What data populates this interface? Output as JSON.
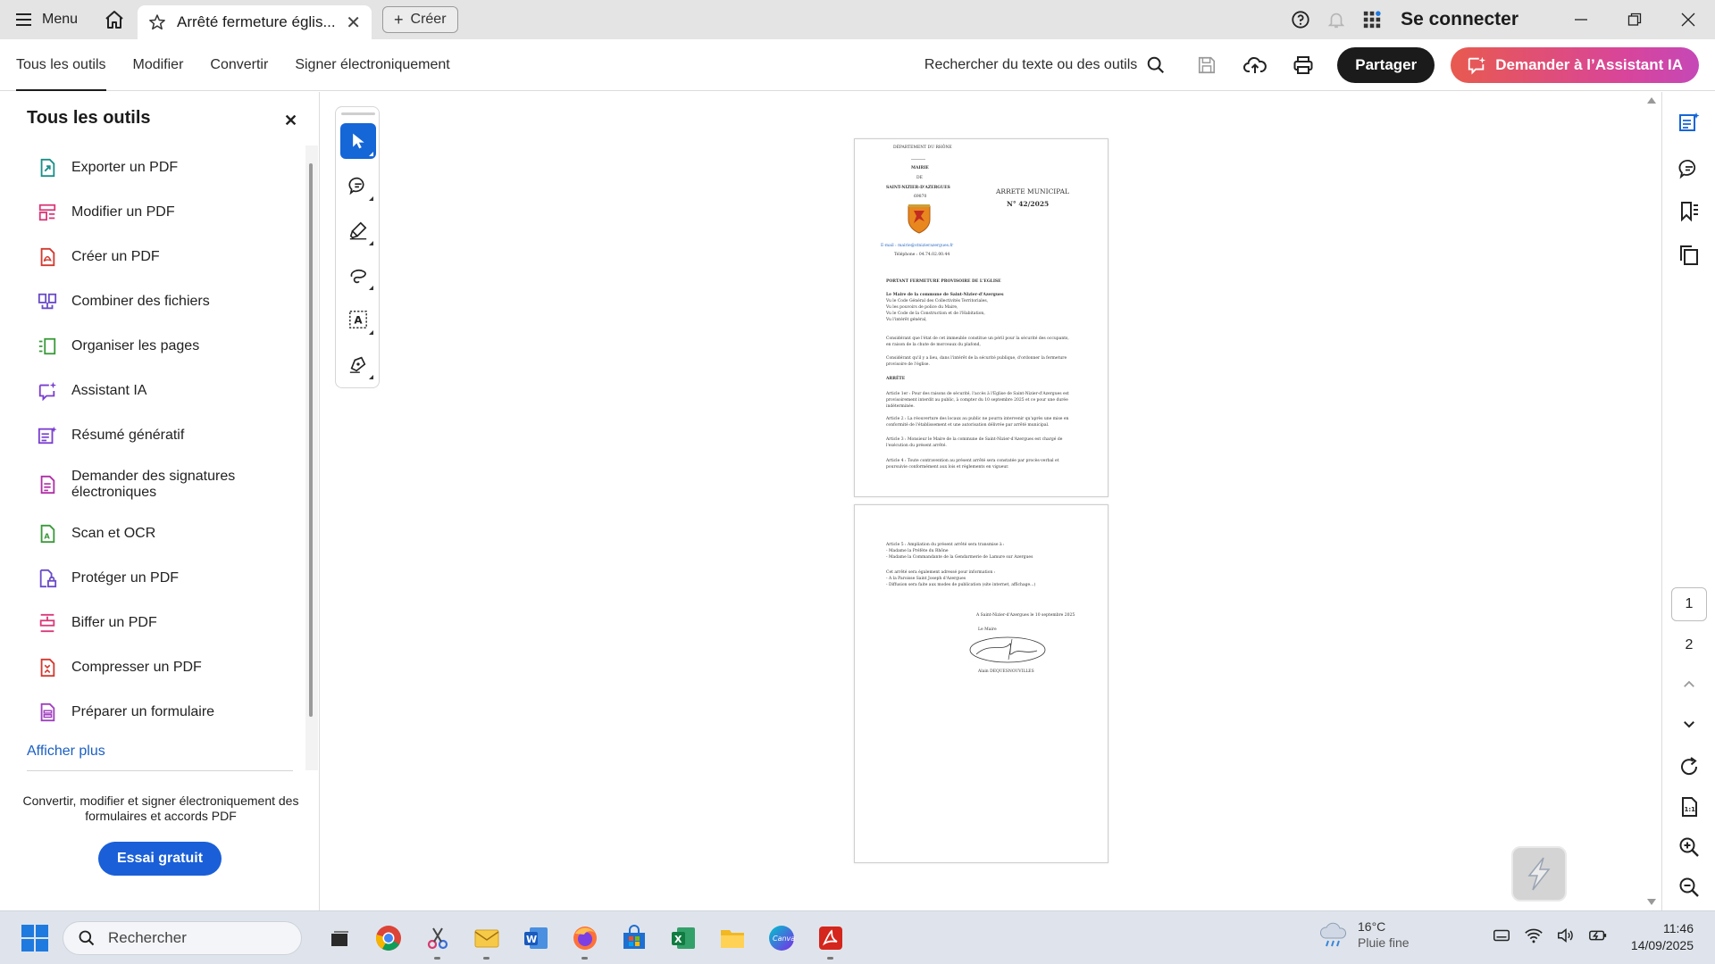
{
  "titlebar": {
    "menu_label": "Menu",
    "tab_title": "Arrêté fermeture églis...",
    "create_label": "Créer",
    "signin_label": "Se connecter"
  },
  "toolbar": {
    "tabs": [
      {
        "label": "Tous les outils"
      },
      {
        "label": "Modifier"
      },
      {
        "label": "Convertir"
      },
      {
        "label": "Signer électroniquement"
      }
    ],
    "search_label": "Rechercher du texte ou des outils",
    "share_label": "Partager",
    "ai_label": "Demander à l’Assistant IA"
  },
  "leftpanel": {
    "title": "Tous les outils",
    "tools": [
      {
        "label": "Exporter un PDF",
        "icon": "export-pdf-icon",
        "color": "#1a8f8a"
      },
      {
        "label": "Modifier un PDF",
        "icon": "edit-pdf-icon",
        "color": "#d93a7a"
      },
      {
        "label": "Créer un PDF",
        "icon": "create-pdf-icon",
        "color": "#d23a2f"
      },
      {
        "label": "Combiner des fichiers",
        "icon": "combine-files-icon",
        "color": "#6a4cc8"
      },
      {
        "label": "Organiser les pages",
        "icon": "organize-pages-icon",
        "color": "#3a9a3a"
      },
      {
        "label": "Assistant IA",
        "icon": "ai-assistant-icon",
        "color": "#7a3fd0"
      },
      {
        "label": "Résumé génératif",
        "icon": "generative-summary-icon",
        "color": "#7a3fd0"
      },
      {
        "label": "Demander des signatures électroniques",
        "icon": "request-signatures-icon",
        "color": "#b02fa6"
      },
      {
        "label": "Scan et OCR",
        "icon": "scan-ocr-icon",
        "color": "#3a9a3a"
      },
      {
        "label": "Protéger un PDF",
        "icon": "protect-pdf-icon",
        "color": "#6a4cc8"
      },
      {
        "label": "Biffer un PDF",
        "icon": "redact-pdf-icon",
        "color": "#d93a7a"
      },
      {
        "label": "Compresser un PDF",
        "icon": "compress-pdf-icon",
        "color": "#d23a2f"
      },
      {
        "label": "Préparer un formulaire",
        "icon": "prepare-form-icon",
        "color": "#a040c0"
      }
    ],
    "show_more": "Afficher plus",
    "promo_text": "Convertir, modifier et signer électroniquement des formulaires et accords PDF",
    "trial_label": "Essai gratuit"
  },
  "document": {
    "page1": {
      "dept": "DÉPARTEMENT DU RHÔNE",
      "mairie": "MAIRIE",
      "de": "DE",
      "commune": "SAINT-NIZIER-D'AZERGUES",
      "postcode": "69870",
      "email": "E-mail : mairie@stnizierazergues.fr",
      "phone": "Téléphone : 04.74.02.00.44",
      "arrete_title": "ARRETE MUNICIPAL",
      "arrete_num": "N° 42/2025",
      "objet": "PORTANT FERMETURE PROVISOIRE DE L'EGLISE",
      "lines": [
        "Le Maire de la commune de Saint-Nizier-d'Azergues",
        "Vu le Code Général des Collectivités Territoriales,",
        "Vu les pouvoirs de police du Maire,",
        "Vu le Code de la Construction et de l'Habitation,",
        "Vu l'intérêt général,"
      ],
      "considerant1": "Considérant que l'état de cet immeuble constitue un péril pour la sécurité des occupants,",
      "considerant1b": "en raison de la chute de morceaux du plafond,",
      "considerant2": "Considérant qu'il y a lieu, dans l'intérêt de la sécurité publique, d'ordonner la fermeture",
      "considerant2b": "provisoire de l'église.",
      "arrete": "ARRÊTE",
      "art1": "Article 1er : Pour des raisons de sécurité, l'accès à l'Eglise de Saint-Nizier-d'Azergues est",
      "art1b": "provisoirement interdit au public, à compter du 10 septembre 2025 et ce pour une durée",
      "art1c": "indéterminée.",
      "art2": "Article 2 : La réouverture des locaux au public ne pourra intervenir qu'après une mise en",
      "art2b": "conformité de l'établissement et une autorisation délivrée par arrêté municipal.",
      "art3": "Article 3 : Monsieur le Maire de la commune de Saint-Nizier-d'Azergues est chargé de",
      "art3b": "l'exécution du présent arrêté.",
      "art4": "Article 4 : Toute contravention au présent arrêté sera constatée par procès-verbal et",
      "art4b": "poursuivie conformément aux lois et règlements en vigueur."
    },
    "page2": {
      "art5": "Article 5 : Ampliation du présent arrêté sera transmise à :",
      "art5a": "- Madame la Préfète du Rhône",
      "art5b": "- Madame la Commandante de la Gendarmerie de Lamure sur Azergues",
      "info": "Cet arrêté sera également adressé pour information :",
      "info_a": "- A la Paroisse Saint Joseph d'Azergues",
      "info_b": "- Diffusion sera faite aux modes de publication (site internet, affichage...)",
      "place_date": "A Saint-Nizier-d'Azergues le 10 septembre 2025",
      "le_maire": "Le Maire",
      "signatory": "Alain DEQUESNOUVILLES"
    }
  },
  "rightrail": {
    "pages": [
      "1",
      "2"
    ],
    "current_page": "1"
  },
  "taskbar": {
    "search_placeholder": "Rechercher",
    "weather_temp": "16°C",
    "weather_desc": "Pluie fine",
    "time": "11:46",
    "date": "14/09/2025"
  }
}
